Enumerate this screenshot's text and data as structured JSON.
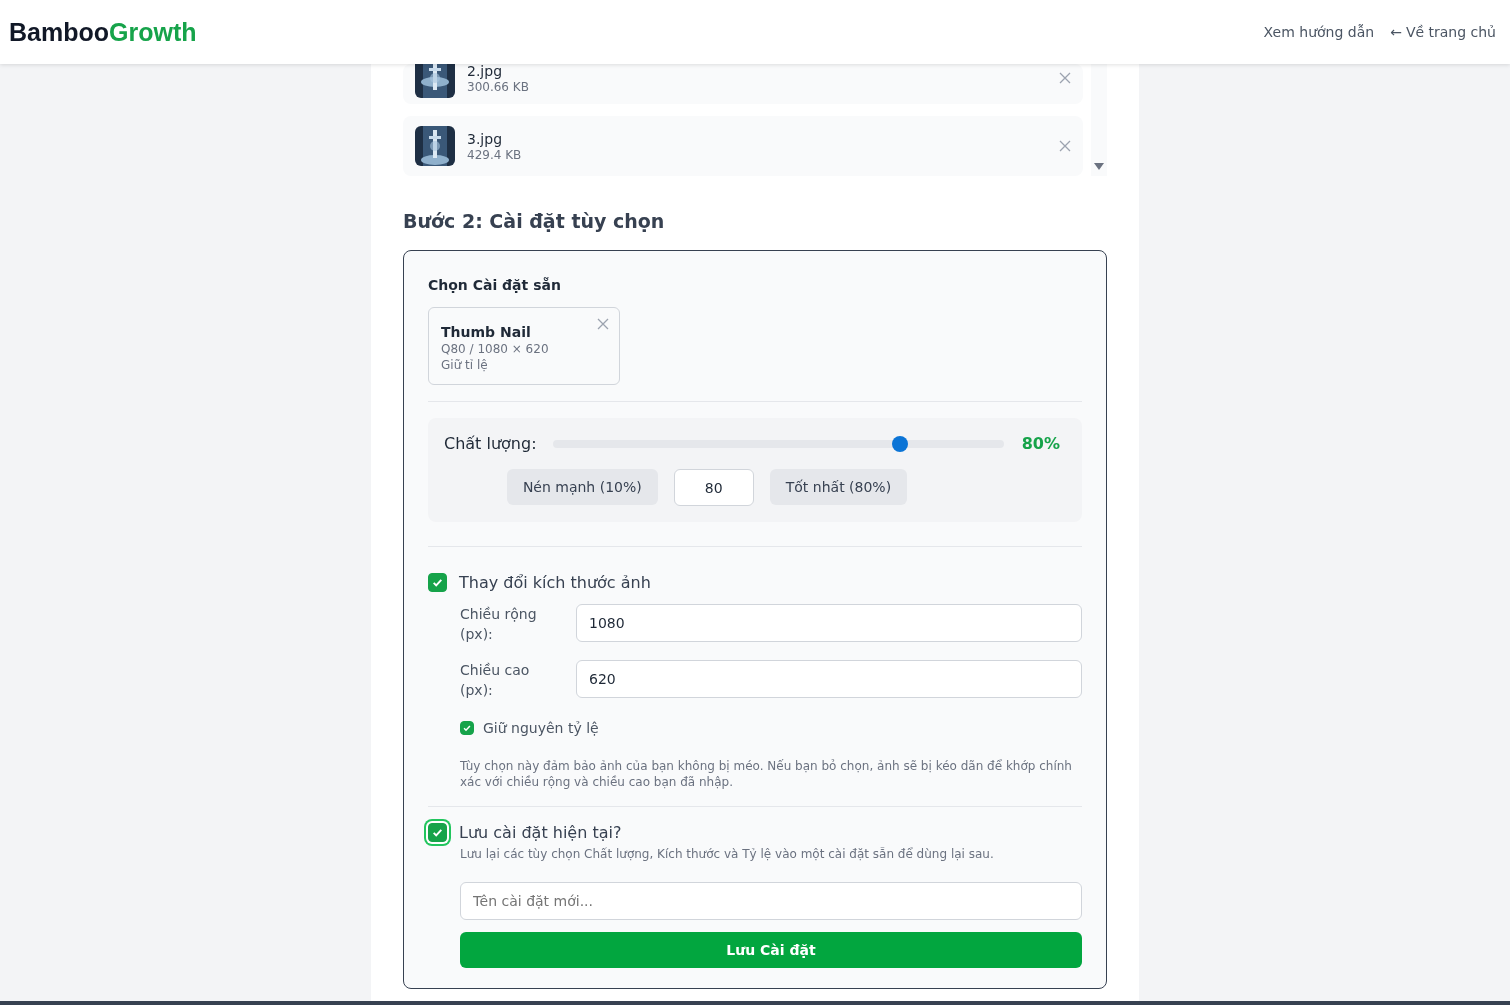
{
  "header": {
    "brand_main": "Bamboo",
    "brand_accent": "Growth",
    "links": [
      {
        "label": "Xem hướng dẫn",
        "kind": "text"
      },
      {
        "label": "Về trang chủ",
        "kind": "back",
        "arrow": "←"
      }
    ]
  },
  "files": [
    {
      "name": "2.jpg",
      "size": "300.66 KB"
    },
    {
      "name": "3.jpg",
      "size": "429.4 KB"
    }
  ],
  "step2": {
    "title": "Bước 2: Cài đặt tùy chọn",
    "presets": {
      "label": "Chọn Cài đặt sẵn",
      "items": [
        {
          "name": "Thumb Nail",
          "detail": "Q80 / 1080 × 620",
          "note": "Giữ tỉ lệ"
        }
      ]
    },
    "quality": {
      "label": "Chất lượng:",
      "level": 0.77,
      "reading": "80%",
      "value": "80",
      "buttons": [
        "Nén mạnh (10%)",
        "Tốt nhất (80%)"
      ]
    },
    "resize": {
      "label": "Thay đổi kích thước ảnh",
      "checked": true,
      "fields": [
        {
          "label": "Chiều rộng (px):",
          "value": "1080"
        },
        {
          "label": "Chiều cao (px):",
          "value": "620"
        }
      ],
      "keep_ratio": {
        "label": "Giữ nguyên tỷ lệ",
        "checked": true
      },
      "hint": "Tùy chọn này đảm bảo ảnh của bạn không bị méo. Nếu bạn bỏ chọn, ảnh sẽ bị kéo dãn để khớp chính xác với chiều rộng và chiều cao bạn đã nhập."
    },
    "save": {
      "label": "Lưu cài đặt hiện tại?",
      "checked": true,
      "focused": true,
      "hint": "Lưu lại các tùy chọn Chất lượng, Kích thước và Tỷ lệ vào một cài đặt sẵn để dùng lại sau.",
      "placeholder": "Tên cài đặt mới...",
      "button": "Lưu Cài đặt"
    }
  }
}
